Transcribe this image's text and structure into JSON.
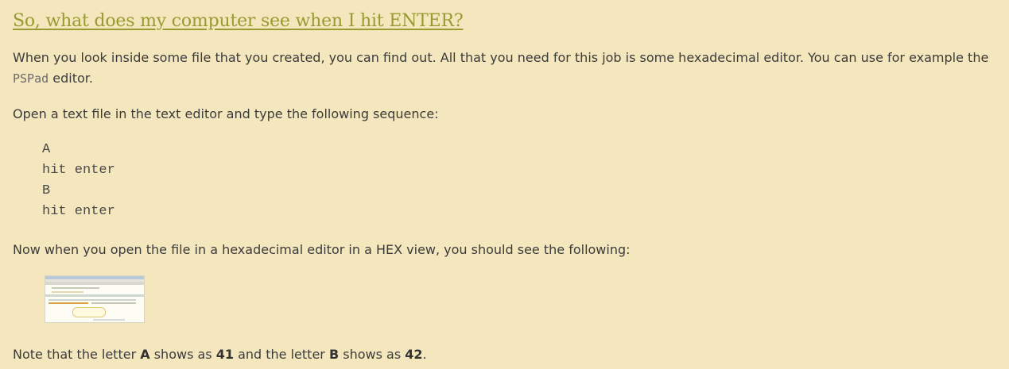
{
  "heading": "So, what does my computer see when I hit ENTER?",
  "intro": {
    "text_before": "When you look inside some file that you created, you can find out. All that you need for this job is some hexadecimal editor. You can use for example the ",
    "code": "PSPad",
    "text_after": " editor."
  },
  "instruction": "Open a text file in the text editor and type the following sequence:",
  "code_block": [
    "A",
    "hit enter",
    "B",
    "hit enter"
  ],
  "hex_intro": "Now when you open the file in a hexadecimal editor in a HEX view, you should see the following:",
  "note": {
    "t1": "Note that the letter ",
    "letter_a": "A",
    "t2": " shows as ",
    "hex_a": "41",
    "t3": " and the letter ",
    "letter_b": "B",
    "t4": " shows as ",
    "hex_b": "42",
    "t5": "."
  },
  "colors": {
    "background": "#f4e6bd",
    "heading": "#9a9a33",
    "text": "#3b3b3b"
  }
}
